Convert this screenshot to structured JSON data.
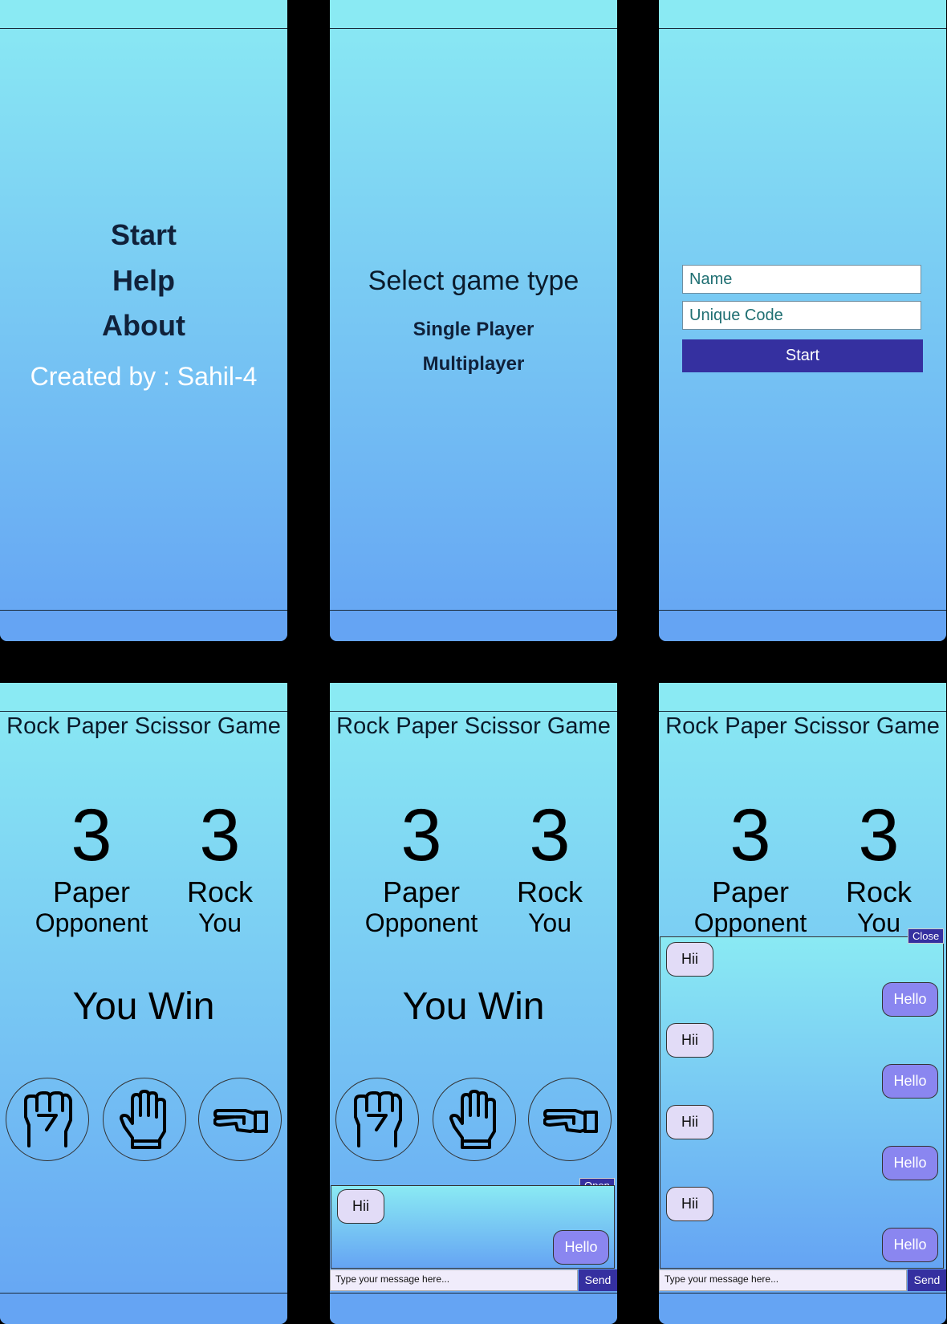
{
  "menu": {
    "start": "Start",
    "help": "Help",
    "about": "About",
    "credit": "Created by : Sahil-4"
  },
  "select": {
    "title": "Select game type",
    "single": "Single Player",
    "multi": "Multiplayer"
  },
  "join": {
    "name_placeholder": "Name",
    "code_placeholder": "Unique Code",
    "start": "Start"
  },
  "game": {
    "title": "Rock Paper Scissor Game",
    "opponent_score": "3",
    "your_score": "3",
    "opponent_move": "Paper",
    "your_move": "Rock",
    "opponent_label": "Opponent",
    "you_label": "You",
    "result": "You Win",
    "choices": [
      "rock-icon",
      "paper-icon",
      "scissors-icon"
    ]
  },
  "chat": {
    "open": "Open",
    "close": "Close",
    "in_msg": "Hii",
    "out_msg": "Hello",
    "placeholder": "Type your message here...",
    "send": "Send"
  },
  "colors": {
    "gradient_top": "#8aeaf3",
    "gradient_bottom": "#65a4f3",
    "accent": "#3530a0",
    "bubble_out": "#8a86f0",
    "bubble_in": "#e2dcf7"
  }
}
